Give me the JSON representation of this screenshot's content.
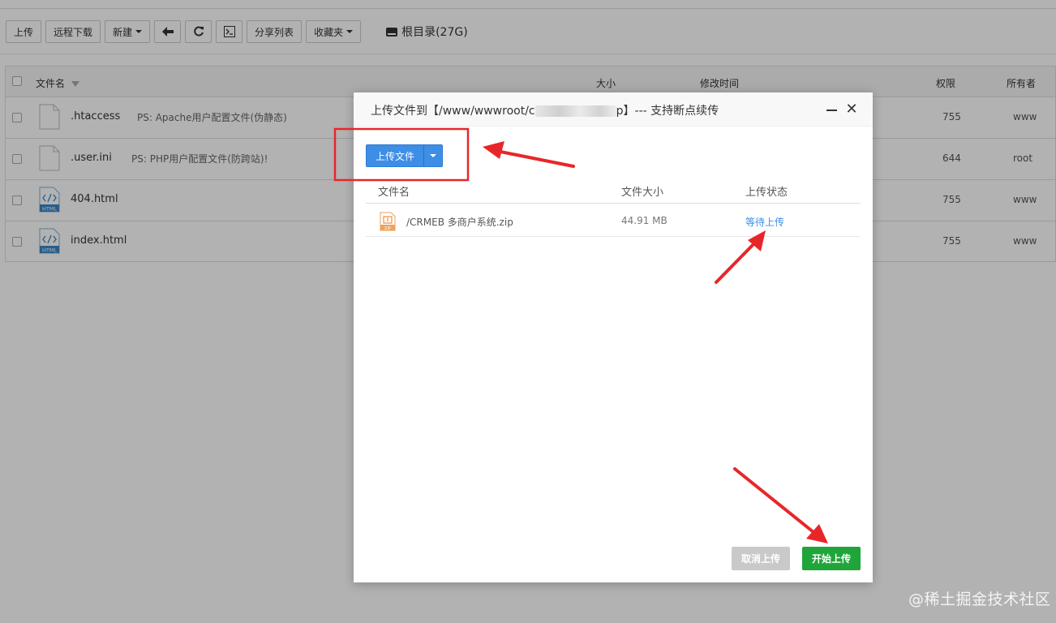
{
  "toolbar": {
    "upload": "上传",
    "remote_download": "远程下载",
    "new": "新建",
    "share_list": "分享列表",
    "favorites": "收藏夹",
    "root_path": "根目录(27G)"
  },
  "table": {
    "headers": {
      "filename": "文件名",
      "size": "大小",
      "modified": "修改时间",
      "permission": "权限",
      "owner": "所有者"
    },
    "rows": [
      {
        "name": ".htaccess",
        "ps": "PS: Apache用户配置文件(伪静态)",
        "perm": "755",
        "owner": "www"
      },
      {
        "name": ".user.ini",
        "ps": "PS: PHP用户配置文件(防跨站)!",
        "perm": "644",
        "owner": "root"
      },
      {
        "name": "404.html",
        "ps": "",
        "perm": "755",
        "owner": "www"
      },
      {
        "name": "index.html",
        "ps": "",
        "perm": "755",
        "owner": "www"
      }
    ]
  },
  "dialog": {
    "title_prefix": "上传文件到【/www/wwwroot/c",
    "title_suffix": "p】--- 支持断点续传",
    "upload_button": "上传文件",
    "columns": {
      "name": "文件名",
      "size": "文件大小",
      "status": "上传状态"
    },
    "files": [
      {
        "name": "/CRMEB 多商户系统.zip",
        "size": "44.91 MB",
        "status": "等待上传"
      }
    ],
    "cancel_button": "取消上传",
    "start_button": "开始上传"
  },
  "icons": {
    "html_label": "HTML",
    "zip_label": "ZIP"
  },
  "colors": {
    "primary": "#3d8ee6",
    "success": "#20a53a",
    "annotation": "#e8262a",
    "link": "#3d8ee6"
  },
  "watermark": "@稀土掘金技术社区"
}
